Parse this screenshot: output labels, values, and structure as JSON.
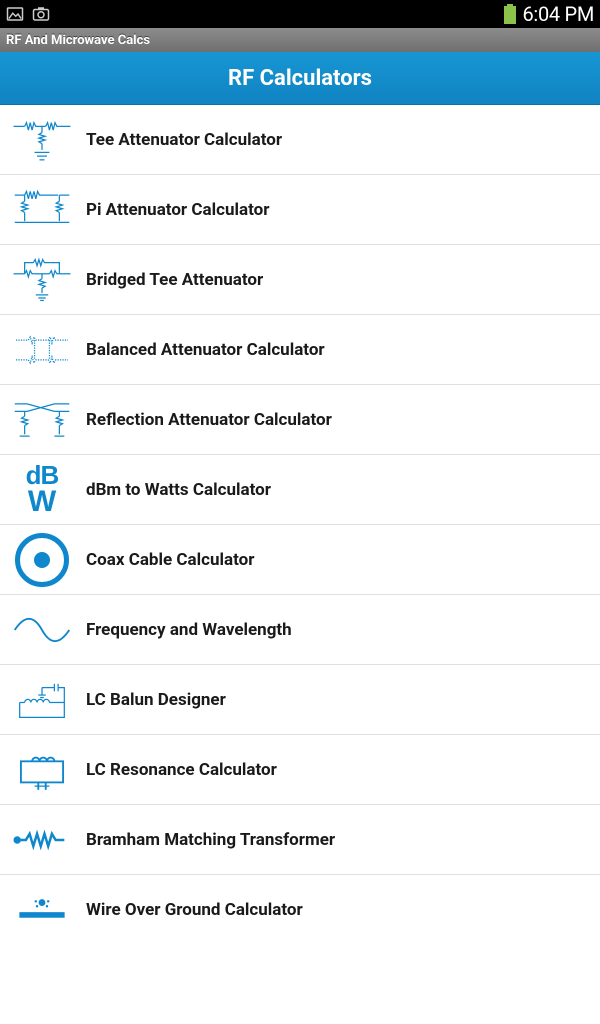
{
  "status": {
    "time": "6:04 PM"
  },
  "app": {
    "title": "RF And Microwave Calcs"
  },
  "header": {
    "title": "RF Calculators"
  },
  "items": [
    {
      "id": "tee-attenuator",
      "label": "Tee Attenuator Calculator"
    },
    {
      "id": "pi-attenuator",
      "label": "Pi Attenuator Calculator"
    },
    {
      "id": "bridged-tee",
      "label": "Bridged Tee Attenuator"
    },
    {
      "id": "balanced-attenuator",
      "label": "Balanced Attenuator Calculator"
    },
    {
      "id": "reflection-attenuator",
      "label": "Reflection Attenuator Calculator"
    },
    {
      "id": "dbm-watts",
      "label": "dBm to Watts Calculator"
    },
    {
      "id": "coax-cable",
      "label": "Coax Cable Calculator"
    },
    {
      "id": "freq-wavelength",
      "label": "Frequency and Wavelength"
    },
    {
      "id": "lc-balun",
      "label": "LC Balun Designer"
    },
    {
      "id": "lc-resonance",
      "label": "LC Resonance Calculator"
    },
    {
      "id": "bramham",
      "label": "Bramham Matching Transformer"
    },
    {
      "id": "wire-over-ground",
      "label": "Wire Over Ground Calculator"
    }
  ]
}
